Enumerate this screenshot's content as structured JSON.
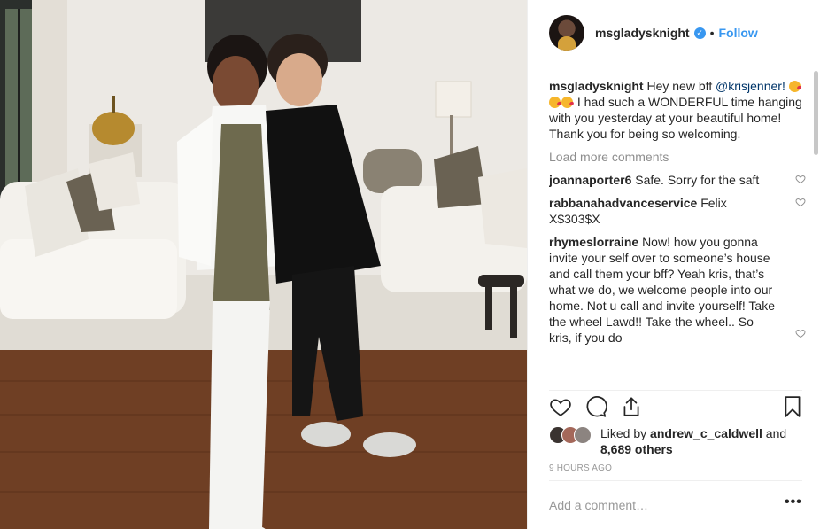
{
  "post": {
    "username": "msgladysknight",
    "verified_glyph": "✓",
    "separator": "•",
    "follow_label": "Follow"
  },
  "caption": {
    "username": "msgladysknight",
    "text_before_mention": "Hey new bff",
    "mention": "@krisjenner!",
    "emoji_names": [
      "kissing-face-emoji",
      "kissing-face-emoji",
      "kissing-face-emoji"
    ],
    "text_after_mention": "I had such a WONDERFUL time hanging with you yesterday at your beautiful home! Thank you for being so welcoming."
  },
  "load_more_label": "Load more comments",
  "comments": [
    {
      "username": "joannaporter6",
      "text": "Safe. Sorry for the saft"
    },
    {
      "username": "rabbanahadvanceservice",
      "text": "Felix X$303$X"
    },
    {
      "username": "rhymeslorraine",
      "text": "Now! how you gonna invite your self over to someone’s house and call them your bff? Yeah kris, that’s what we do, we welcome people into our home. Not u call and invite yourself! Take the wheel Lawd!! Take the wheel.. So kris, if you do"
    }
  ],
  "actions": {
    "icons": [
      "heart-icon",
      "comment-icon",
      "share-icon",
      "bookmark-icon"
    ]
  },
  "likes": {
    "prefix": "Liked by",
    "user": "andrew_c_caldwell",
    "connector": "and",
    "others": "8,689 others"
  },
  "timestamp": "9 hours ago",
  "add_comment_placeholder": "Add a comment…",
  "more_options_glyph": "•••",
  "colors": {
    "accent": "#3897f0",
    "mention": "#003569",
    "text": "#262626",
    "muted": "#8e8e8e"
  }
}
